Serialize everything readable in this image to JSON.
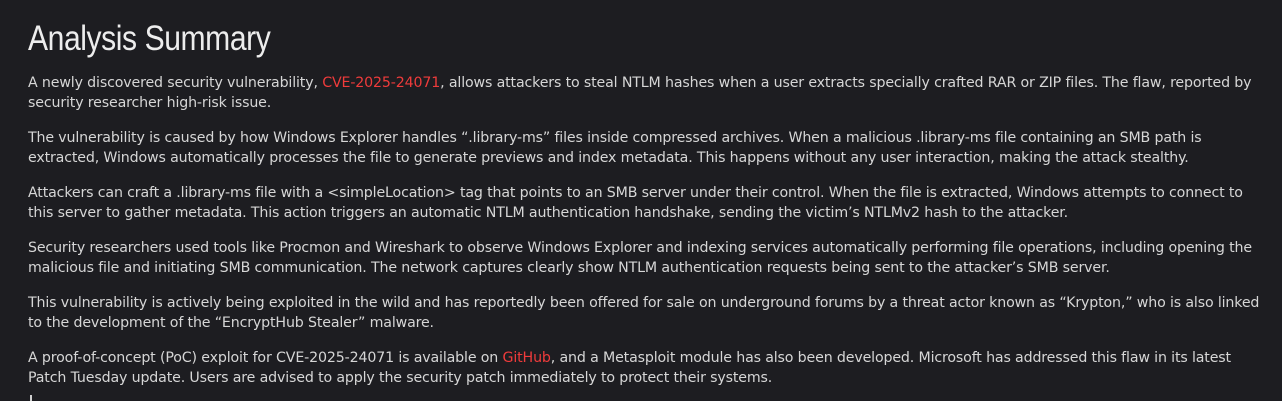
{
  "title": "Analysis Summary",
  "paragraphs": {
    "p1": {
      "before": "A newly discovered security vulnerability, ",
      "link": "CVE-2025-24071",
      "after": ", allows attackers to steal NTLM hashes when a user extracts specially crafted RAR or ZIP files. The flaw, reported by security researcher high-risk issue."
    },
    "p2": "The vulnerability is caused by how Windows Explorer handles “.library-ms” files inside compressed archives. When a malicious .library-ms file containing an SMB path is extracted, Windows automatically processes the file to generate previews and index metadata. This happens without any user interaction, making the attack stealthy.",
    "p3": "Attackers can craft a .library-ms file with a <simpleLocation> tag that points to an SMB server under their control. When the file is extracted, Windows attempts to connect to this server to gather metadata. This action triggers an automatic NTLM authentication handshake, sending the victim’s NTLMv2 hash to the attacker.",
    "p4": "Security researchers used tools like Procmon and Wireshark to observe Windows Explorer and indexing services automatically performing file operations, including opening the malicious file and initiating SMB communication. The network captures clearly show NTLM authentication requests being sent to the attacker’s SMB server.",
    "p5": "This vulnerability is actively being exploited in the wild and has reportedly been offered for sale on underground forums by a threat actor known as “Krypton,” who is also linked to the development of the “EncryptHub Stealer” malware.",
    "p6": {
      "before": "A proof-of-concept (PoC) exploit for CVE-2025-24071 is available on ",
      "link": "GitHub",
      "after": ", and a Metasploit module has also been developed. Microsoft has addressed this flaw in its latest Patch Tuesday update. Users are advised to apply the security patch immediately to protect their systems."
    }
  },
  "colors": {
    "background": "#1d1d21",
    "text": "#d6d6d6",
    "link": "#ef3b3b"
  }
}
